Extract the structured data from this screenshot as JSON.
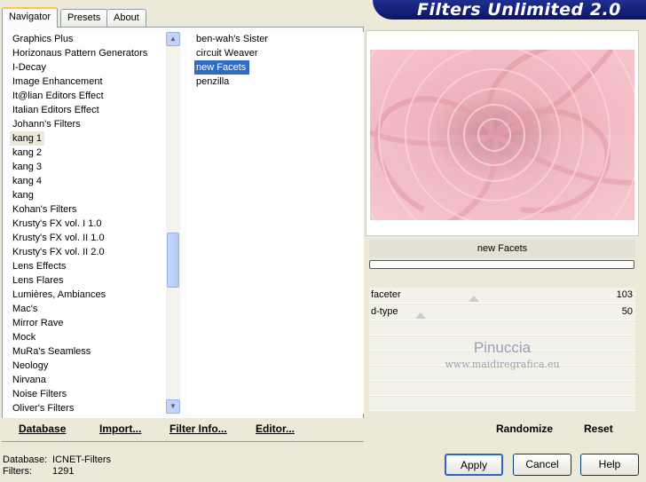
{
  "tabs": [
    {
      "label": "Navigator",
      "active": true
    },
    {
      "label": "Presets",
      "active": false
    },
    {
      "label": "About",
      "active": false
    }
  ],
  "title": "Filters Unlimited 2.0",
  "categories": [
    "Graphics Plus",
    "Horizonaus Pattern Generators",
    "I-Decay",
    "Image Enhancement",
    "It@lian Editors Effect",
    "Italian Editors Effect",
    "Johann's Filters",
    "kang 1",
    "kang 2",
    "kang 3",
    "kang 4",
    "kang",
    "Kohan's Filters",
    "Krusty's FX vol. I 1.0",
    "Krusty's FX vol. II 1.0",
    "Krusty's FX vol. II 2.0",
    "Lens Effects",
    "Lens Flares",
    "Lumières, Ambiances",
    "Mac's",
    "Mirror Rave",
    "Mock",
    "MuRa's Seamless",
    "Neology",
    "Nirvana",
    "Noise Filters",
    "Oliver's Filters"
  ],
  "selected_category": "kang 1",
  "filters": [
    "ben-wah's Sister",
    "circuit Weaver",
    "new Facets",
    "penzilla"
  ],
  "selected_filter": "new Facets",
  "preview": {
    "filter_name": "new Facets",
    "color": "#f2b8c0"
  },
  "params": [
    {
      "name": "faceter",
      "value": "103"
    },
    {
      "name": "d-type",
      "value": "50"
    }
  ],
  "watermark": {
    "line1": "Pinuccia",
    "line2": "www.maidiregrafica.eu"
  },
  "bottom_left": {
    "database": "Database",
    "import": "Import...",
    "filter_info": "Filter Info...",
    "editor": "Editor..."
  },
  "bottom_right": {
    "randomize": "Randomize",
    "reset": "Reset"
  },
  "status": {
    "database_label": "Database:",
    "database_value": "ICNET-Filters",
    "filters_label": "Filters:",
    "filters_value": "1291"
  },
  "buttons": {
    "apply": "Apply",
    "cancel": "Cancel",
    "help": "Help"
  }
}
